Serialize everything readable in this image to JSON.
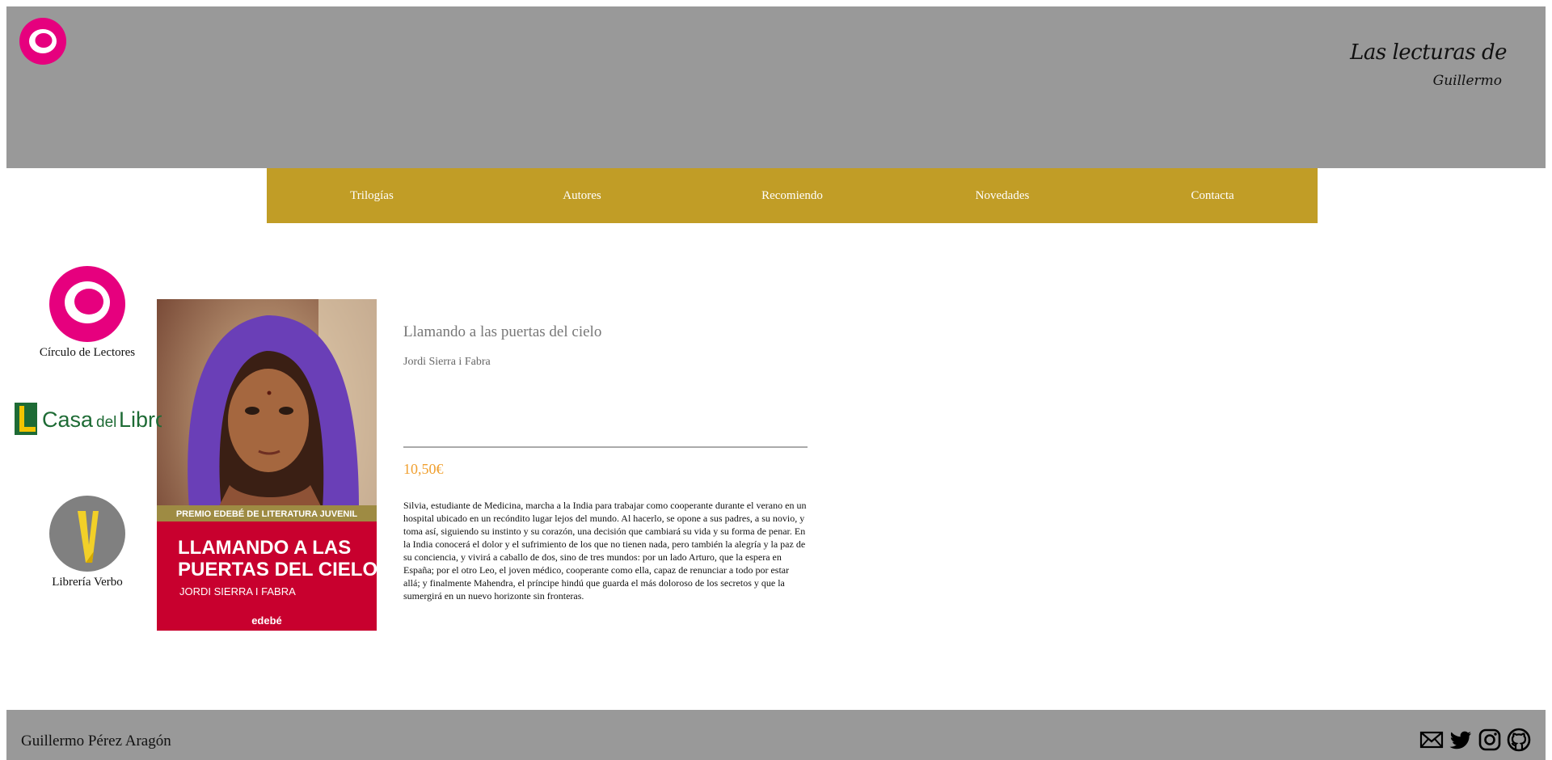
{
  "header": {
    "title_line1": "Las lecturas de",
    "title_line2": "Guillermo",
    "logo_icon": "circulo-ring-logo-icon"
  },
  "nav": {
    "items": [
      "Trilogías",
      "Autores",
      "Recomiendo",
      "Novedades",
      "Contacta"
    ]
  },
  "book": {
    "title": "Llamando a las puertas del cielo",
    "author": "Jordi Sierra i Fabra",
    "price": "10,50€",
    "synopsis": "Silvia, estudiante de Medicina, marcha a la India para trabajar como cooperante durante el verano en un hospital ubicado en un recóndito lugar lejos del mundo. Al hacerlo, se opone a sus padres, a su novio, y toma así, siguiendo su instinto y su corazón, una decisión que cambiará su vida y su forma de penar. En la India conocerá el dolor y el sufrimiento de los que no tienen nada, pero también la alegría y la paz de su conciencia, y vivirá a caballo de dos, sino de tres mundos: por un lado Arturo, que la espera en España; por el otro Leo, el joven médico, cooperante como ella, capaz de renunciar a todo por estar allá; y finalmente Mahendra, el príncipe hindú que guarda el más doloroso de los secretos y que la sumergirá en un nuevo horizonte sin fronteras.",
    "cover": {
      "banner": "PREMIO EDEBÉ DE LITERATURA JUVENIL",
      "title_line1": "LLAMANDO A LAS",
      "title_line2": "PUERTAS DEL CIELO",
      "author": "JORDI SIERRA I FABRA",
      "publisher": "edebé"
    }
  },
  "stores": [
    {
      "label": "Círculo de Lectores",
      "icon": "circulo-logo-icon"
    },
    {
      "label": "Casa del Libro",
      "icon": "casa-del-libro-logo",
      "logo_word1": "Casa",
      "logo_word2": "del",
      "logo_word3": "Libro"
    },
    {
      "label": "Librería Verbo",
      "icon": "verbo-logo-icon"
    }
  ],
  "footer": {
    "name": "Guillermo Pérez Aragón",
    "social": [
      "mail-icon",
      "twitter-icon",
      "instagram-icon",
      "github-icon"
    ]
  },
  "colors": {
    "header_bg": "#999999",
    "nav_bg": "#c19d26",
    "price": "#f0a030",
    "circulo_pink": "#e6007e",
    "casa_green": "#1e6b35",
    "verbo_gray": "#808080",
    "verbo_yellow": "#f2d028"
  }
}
